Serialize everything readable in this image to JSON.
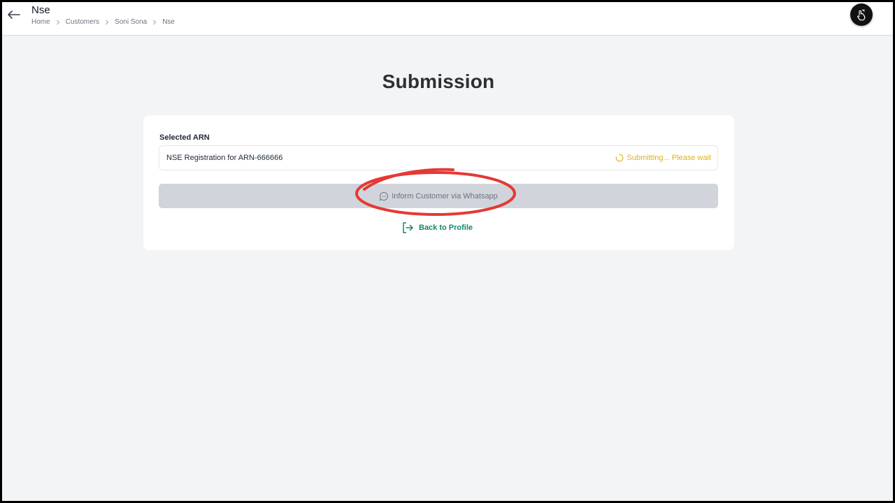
{
  "header": {
    "title": "Nse",
    "breadcrumb": [
      "Home",
      "Customers",
      "Soni Sona",
      "Nse"
    ]
  },
  "main": {
    "heading": "Submission",
    "selected_arn_label": "Selected ARN",
    "arn_value": "NSE Registration for ARN-666666",
    "status_text": "Submitting... Please wait",
    "whatsapp_button_label": "Inform Customer via Whatsapp",
    "back_link_label": "Back to Profile"
  },
  "icons": {
    "back": "arrow-left-icon",
    "breadcrumb_separator": "chevron-right-icon",
    "avatar": "user-avatar",
    "status": "spinner-icon",
    "whatsapp": "chat-bubble-icon",
    "back_to_profile": "exit-icon"
  },
  "colors": {
    "background": "#f3f4f6",
    "card": "#ffffff",
    "status_text": "#e0b317",
    "disabled_button": "#d1d5db",
    "link": "#0f8a6b",
    "annotation": "#e53935"
  }
}
